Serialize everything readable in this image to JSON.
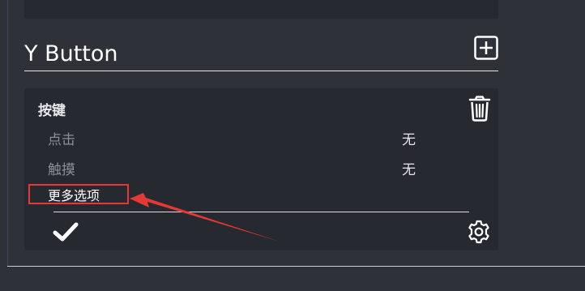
{
  "section": {
    "title": "Y Button",
    "add_icon": "plus-square-icon"
  },
  "card": {
    "title": "按键",
    "delete_icon": "trash-icon",
    "rows": [
      {
        "label": "点击",
        "value": "无"
      },
      {
        "label": "触摸",
        "value": "无"
      }
    ],
    "more_options": "更多选项",
    "confirm_icon": "check-icon",
    "settings_icon": "gear-icon"
  },
  "annotation": {
    "highlight_color": "#e53935"
  }
}
